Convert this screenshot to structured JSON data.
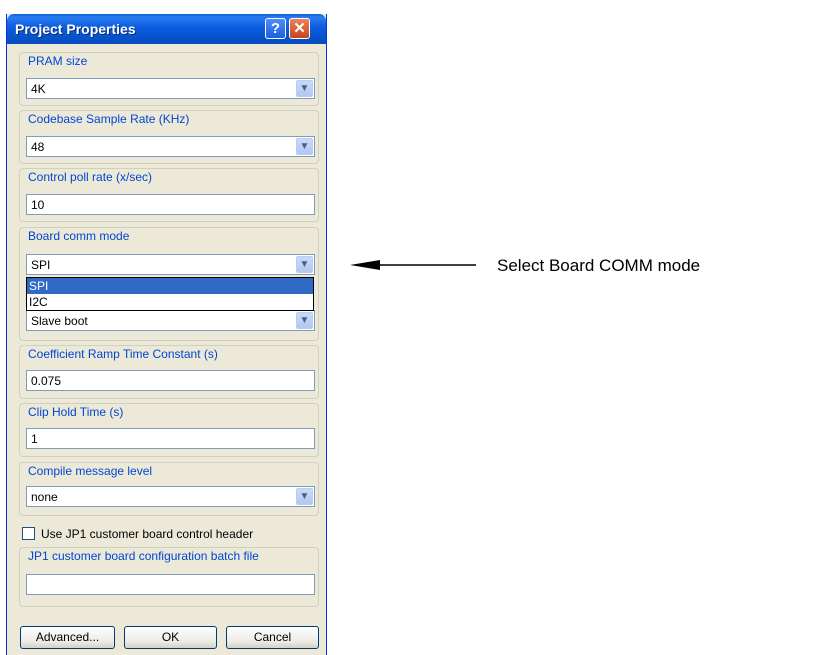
{
  "window": {
    "title": "Project Properties",
    "help_label": "?",
    "close_label": "✕"
  },
  "groups": {
    "pram": {
      "label": "PRAM size",
      "value": "4K"
    },
    "sample_rate": {
      "label": "Codebase Sample Rate (KHz)",
      "value": "48"
    },
    "poll_rate": {
      "label": "Control poll rate (x/sec)",
      "value": "10"
    },
    "comm_mode": {
      "label": "Board comm mode",
      "value": "SPI",
      "options": [
        "SPI",
        "I2C"
      ],
      "selected_option": "SPI",
      "boot_value": "Slave boot"
    },
    "ramp": {
      "label": "Coefficient Ramp Time Constant (s)",
      "value": "0.075"
    },
    "clip_hold": {
      "label": "Clip Hold Time (s)",
      "value": "1"
    },
    "compile_level": {
      "label": "Compile message level",
      "value": "none"
    },
    "batch_file": {
      "label": "JP1 customer board configuration batch file",
      "value": ""
    }
  },
  "checkbox": {
    "label": "Use JP1 customer board control header",
    "checked": false
  },
  "buttons": {
    "advanced": "Advanced...",
    "ok": "OK",
    "cancel": "Cancel"
  },
  "annotation": {
    "text": "Select Board COMM mode"
  },
  "icons": {
    "dropdown": "chevron-down-icon",
    "arrow": "arrow-left-icon"
  },
  "colors": {
    "title_bar": "#0a5fd6",
    "group_label": "#0046d5",
    "selection": "#316ac5"
  }
}
